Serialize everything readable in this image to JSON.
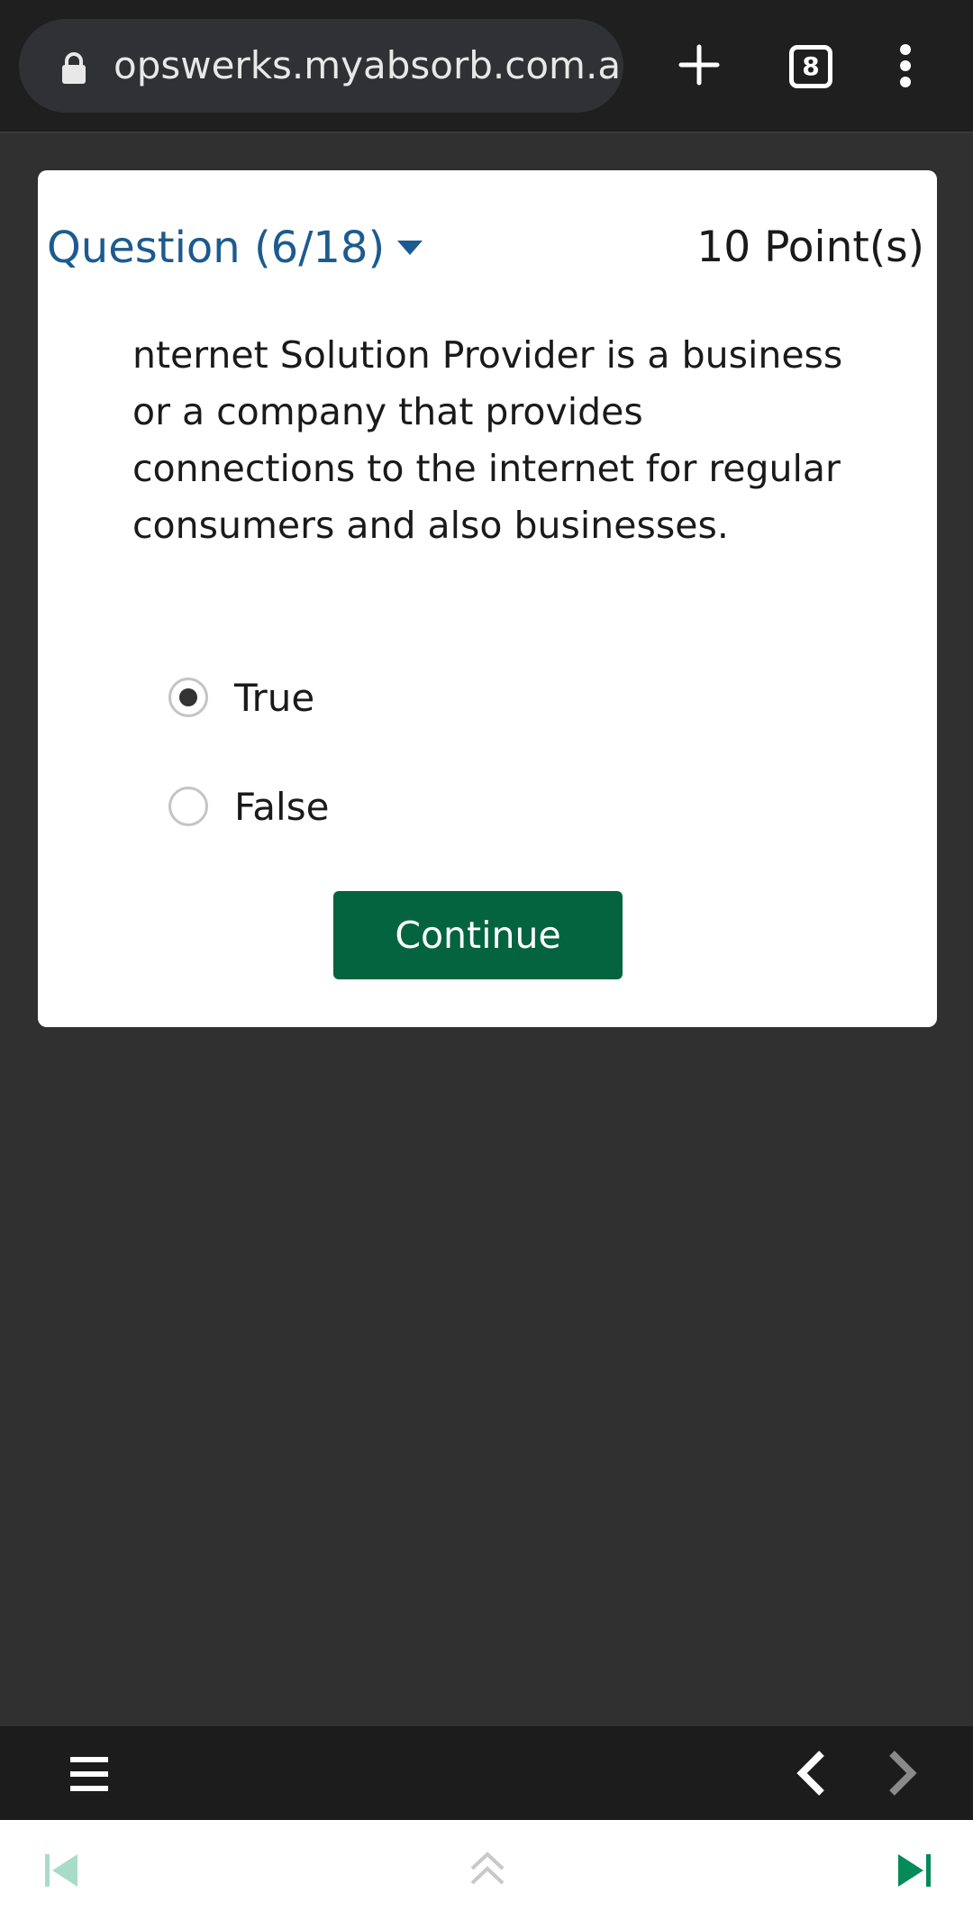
{
  "browser": {
    "url": "opswerks.myabsorb.com.au",
    "tab_count": "8"
  },
  "question": {
    "selector_label": "Question (6/18)",
    "points": "10 Point(s)",
    "text": "nternet Solution Provider is a business or a company that provides connections to the internet for regular consumers and also businesses.",
    "options": [
      {
        "label": "True",
        "selected": true
      },
      {
        "label": "False",
        "selected": false
      }
    ],
    "continue_label": "Continue"
  },
  "colors": {
    "accent_green": "#04643f",
    "question_blue": "#1c5b8f",
    "background": "#303030"
  },
  "icons": {
    "browser": [
      "lock-icon",
      "new-tab-icon",
      "tabs-count-icon",
      "more-menu-icon"
    ],
    "player_bar": [
      "hamburger-menu-icon",
      "chevron-left-icon",
      "chevron-right-icon"
    ],
    "nav_bar": [
      "skip-back-icon",
      "double-chevron-up-icon",
      "skip-forward-icon"
    ]
  }
}
